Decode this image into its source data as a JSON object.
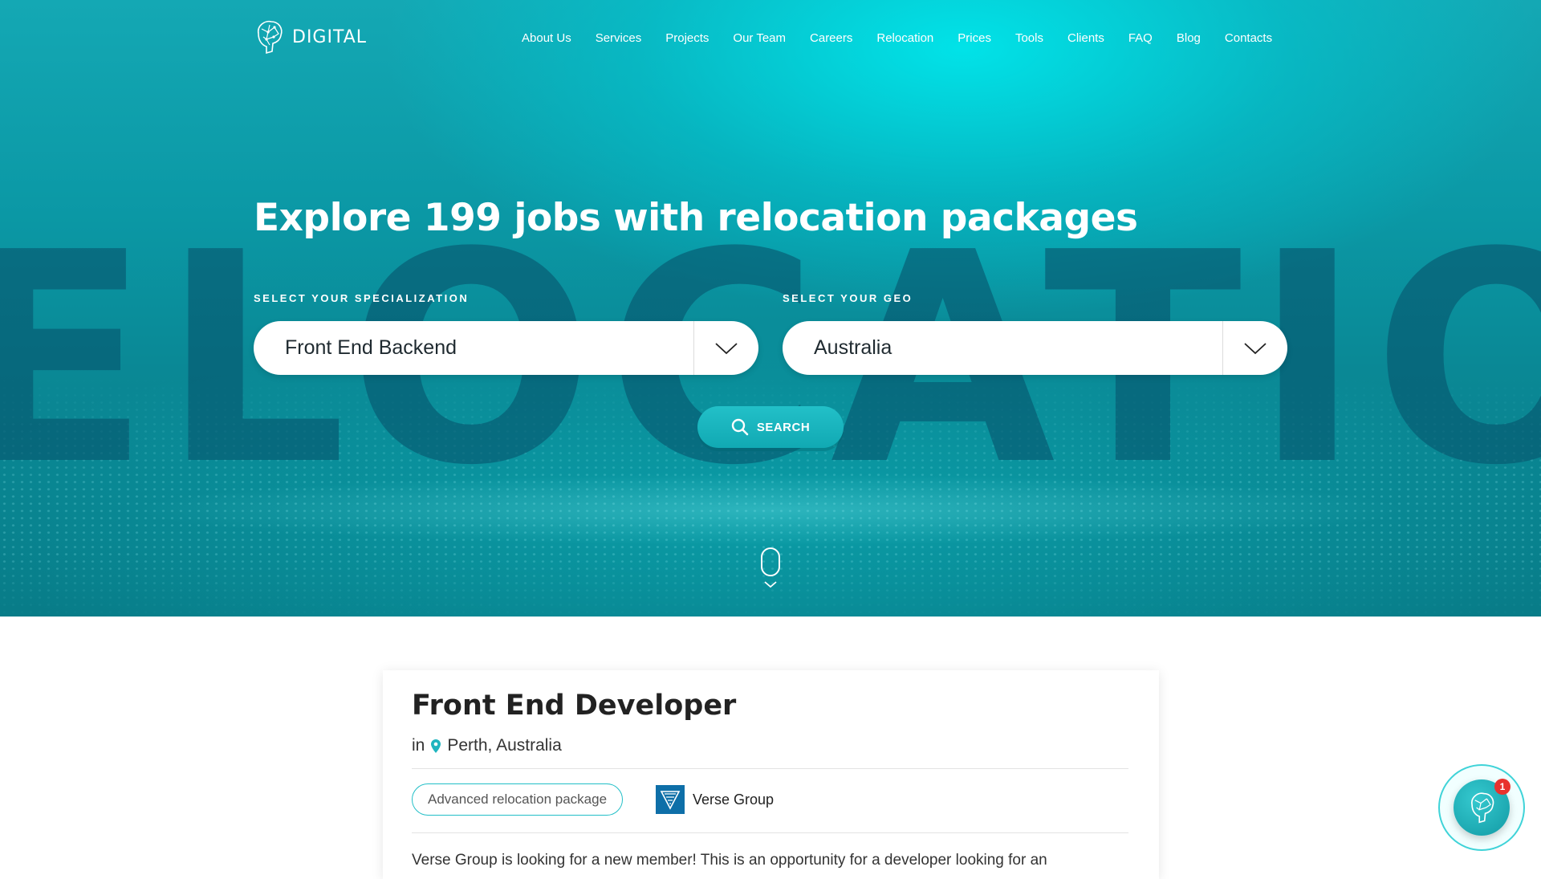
{
  "brand": {
    "logo_text": "DIGITAL"
  },
  "nav": {
    "items": [
      {
        "label": "About Us"
      },
      {
        "label": "Services"
      },
      {
        "label": "Projects"
      },
      {
        "label": "Our Team"
      },
      {
        "label": "Careers"
      },
      {
        "label": "Relocation"
      },
      {
        "label": "Prices"
      },
      {
        "label": "Tools"
      },
      {
        "label": "Clients"
      },
      {
        "label": "FAQ"
      },
      {
        "label": "Blog"
      },
      {
        "label": "Contacts"
      }
    ]
  },
  "hero": {
    "background_word": "ELOCATIO",
    "headline": "Explore 199 jobs with relocation packages",
    "specialization": {
      "label": "SELECT YOUR SPECIALIZATION",
      "value": "Front End Backend"
    },
    "geo": {
      "label": "SELECT YOUR GEO",
      "value": "Australia"
    },
    "search_label": "SEARCH",
    "accent_color": "#11a9b3"
  },
  "job_card": {
    "title": "Front End Developer",
    "in_label": "in",
    "location": "Perth, Australia",
    "tag": "Advanced relocation package",
    "company": "Verse Group",
    "description": "Verse Group is looking for a new member! This is an opportunity for a developer looking for an"
  },
  "chat": {
    "badge_count": "1",
    "icon": "chat-logo-icon"
  }
}
